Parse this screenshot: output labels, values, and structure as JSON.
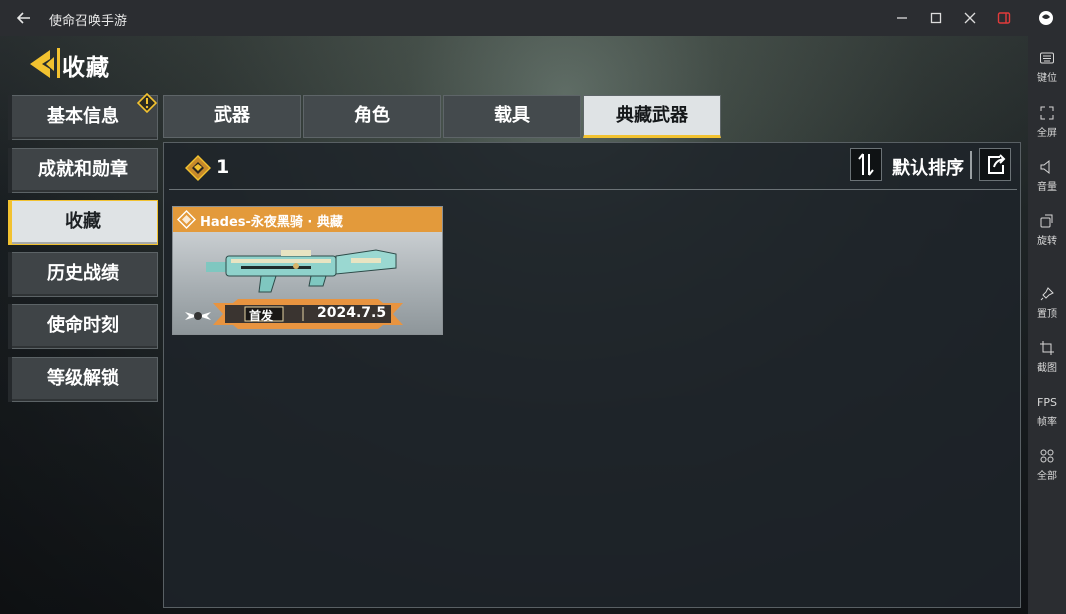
{
  "window": {
    "title": "使命召唤手游",
    "back_icon": "arrow-left-icon",
    "controls": [
      "minimize-icon",
      "maximize-icon",
      "close-icon",
      "sidebar-toggle-icon"
    ]
  },
  "header": {
    "title": "收藏",
    "accent": "#f2c230"
  },
  "nav": {
    "items": [
      {
        "label": "基本信息",
        "active": false
      },
      {
        "label": "成就和勋章",
        "active": false
      },
      {
        "label": "收藏",
        "active": true
      },
      {
        "label": "历史战绩",
        "active": false
      },
      {
        "label": "使命时刻",
        "active": false
      },
      {
        "label": "等级解锁",
        "active": false
      }
    ]
  },
  "tabs": [
    {
      "label": "武器",
      "active": false
    },
    {
      "label": "角色",
      "active": false
    },
    {
      "label": "载具",
      "active": false
    },
    {
      "label": "典藏武器",
      "active": true
    }
  ],
  "toolbar": {
    "count": "1",
    "sort_label": "默认排序",
    "sort_icon": "sort-swap-icon",
    "share_icon": "share-icon"
  },
  "items": [
    {
      "name": "Hades-永夜黑骑 · 典藏",
      "ribbon_first": "首发",
      "ribbon_date": "2024.7.5",
      "header_color": "#e39a3b"
    }
  ],
  "right_toolbar": [
    {
      "label": "键位",
      "icon": "keyboard-icon"
    },
    {
      "label": "全屏",
      "icon": "fullscreen-icon"
    },
    {
      "label": "音量",
      "icon": "volume-icon"
    },
    {
      "label": "旋转",
      "icon": "rotate-icon"
    },
    {
      "label": "置顶",
      "icon": "pin-icon"
    },
    {
      "label": "截图",
      "icon": "crop-icon"
    },
    {
      "label": "帧率",
      "icon": "fps-icon",
      "badge": "FPS"
    },
    {
      "label": "全部",
      "icon": "grid-icon"
    }
  ]
}
